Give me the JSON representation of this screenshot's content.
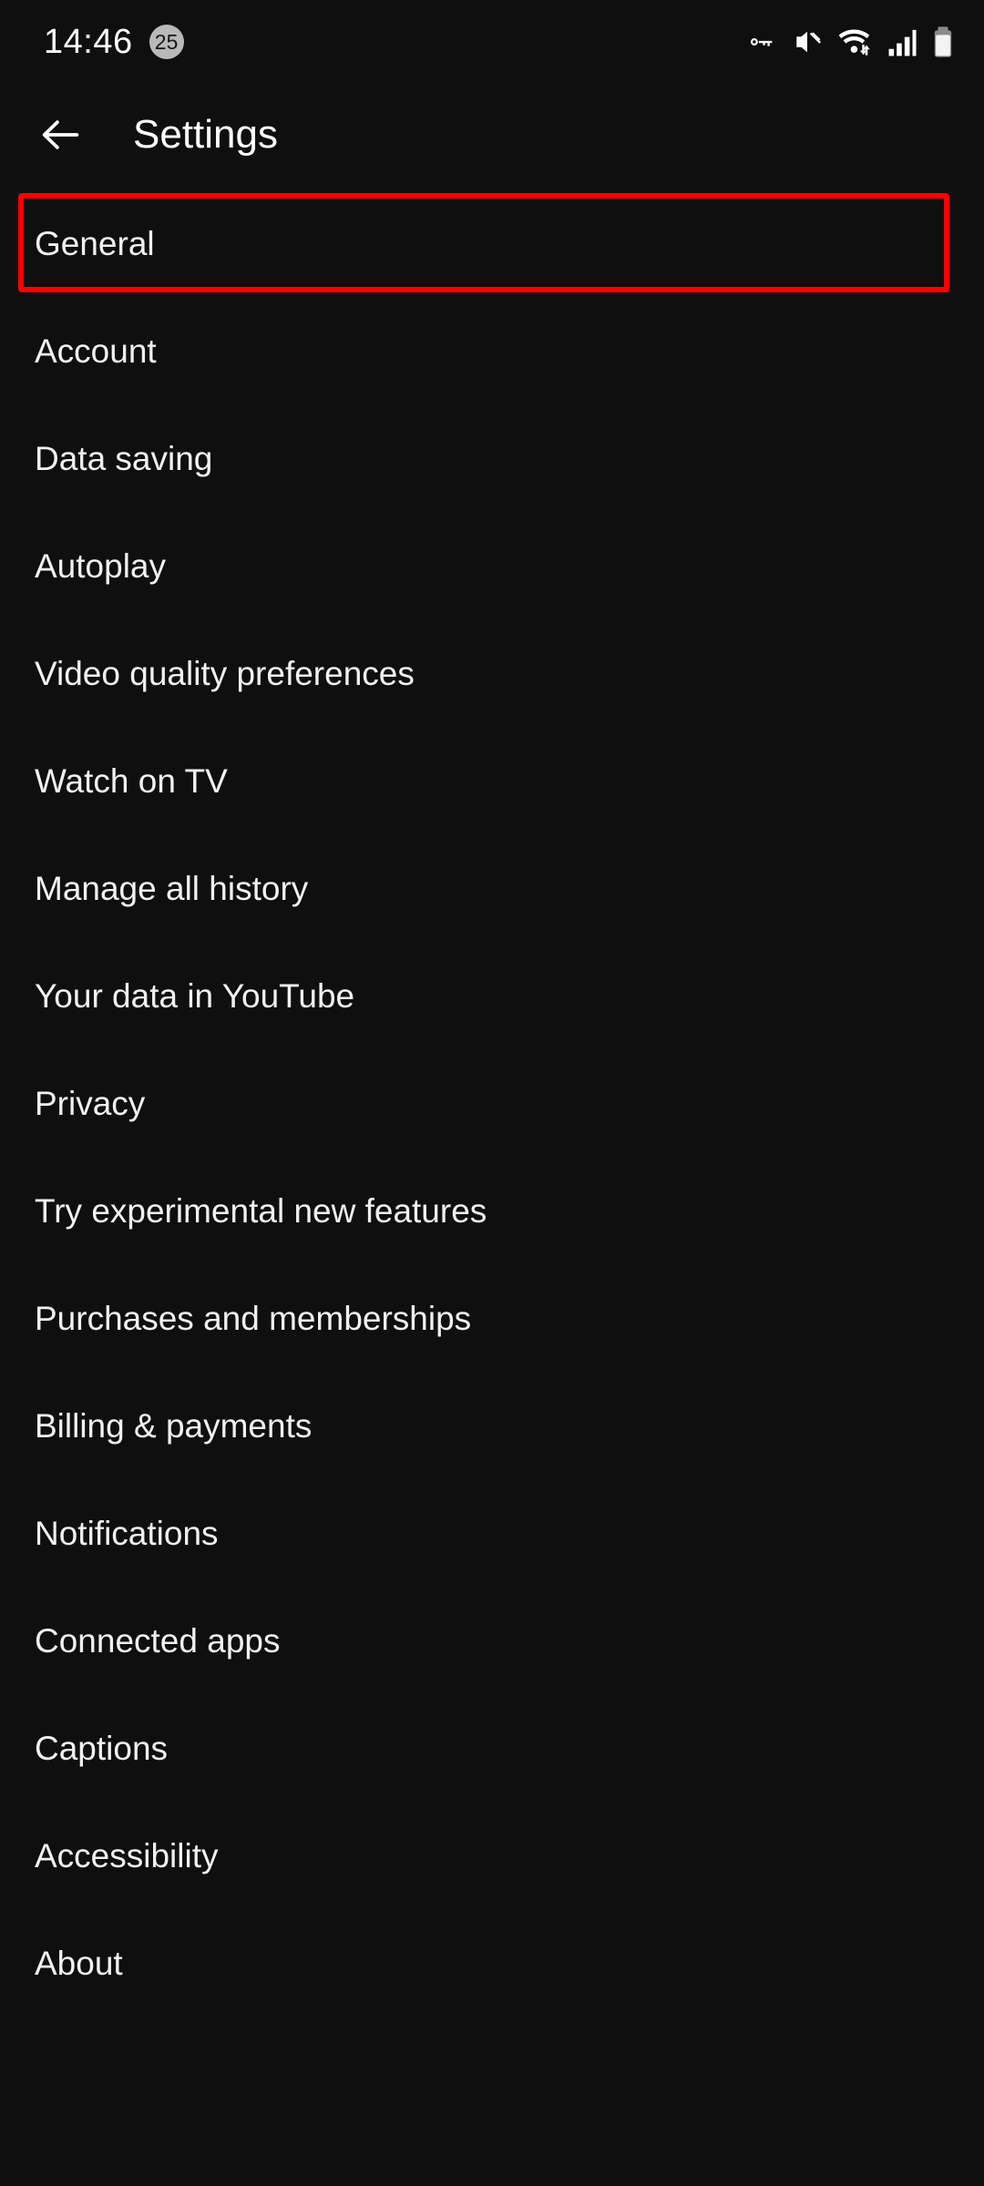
{
  "status_bar": {
    "time": "14:46",
    "notification_badge_count": "25",
    "icons": [
      "vpn-key-icon",
      "volume-muted-icon",
      "wifi-data-transfer-icon",
      "cellular-signal-icon",
      "battery-full-icon"
    ],
    "badge_bg_color": "#b9b9b9",
    "text_color": "#ffffff"
  },
  "app_bar": {
    "back_icon": "back-arrow-icon",
    "title": "Settings"
  },
  "settings": {
    "items": [
      {
        "label": "General",
        "highlighted": true
      },
      {
        "label": "Account",
        "highlighted": false
      },
      {
        "label": "Data saving",
        "highlighted": false
      },
      {
        "label": "Autoplay",
        "highlighted": false
      },
      {
        "label": "Video quality preferences",
        "highlighted": false
      },
      {
        "label": "Watch on TV",
        "highlighted": false
      },
      {
        "label": "Manage all history",
        "highlighted": false
      },
      {
        "label": "Your data in YouTube",
        "highlighted": false
      },
      {
        "label": "Privacy",
        "highlighted": false
      },
      {
        "label": "Try experimental new features",
        "highlighted": false
      },
      {
        "label": "Purchases and memberships",
        "highlighted": false
      },
      {
        "label": "Billing & payments",
        "highlighted": false
      },
      {
        "label": "Notifications",
        "highlighted": false
      },
      {
        "label": "Connected apps",
        "highlighted": false
      },
      {
        "label": "Captions",
        "highlighted": false
      },
      {
        "label": "Accessibility",
        "highlighted": false
      },
      {
        "label": "About",
        "highlighted": false
      }
    ]
  },
  "theme": {
    "background": "#0f0f0f",
    "text_primary": "#f1f1f1",
    "highlight_outline": "#fe0000"
  }
}
